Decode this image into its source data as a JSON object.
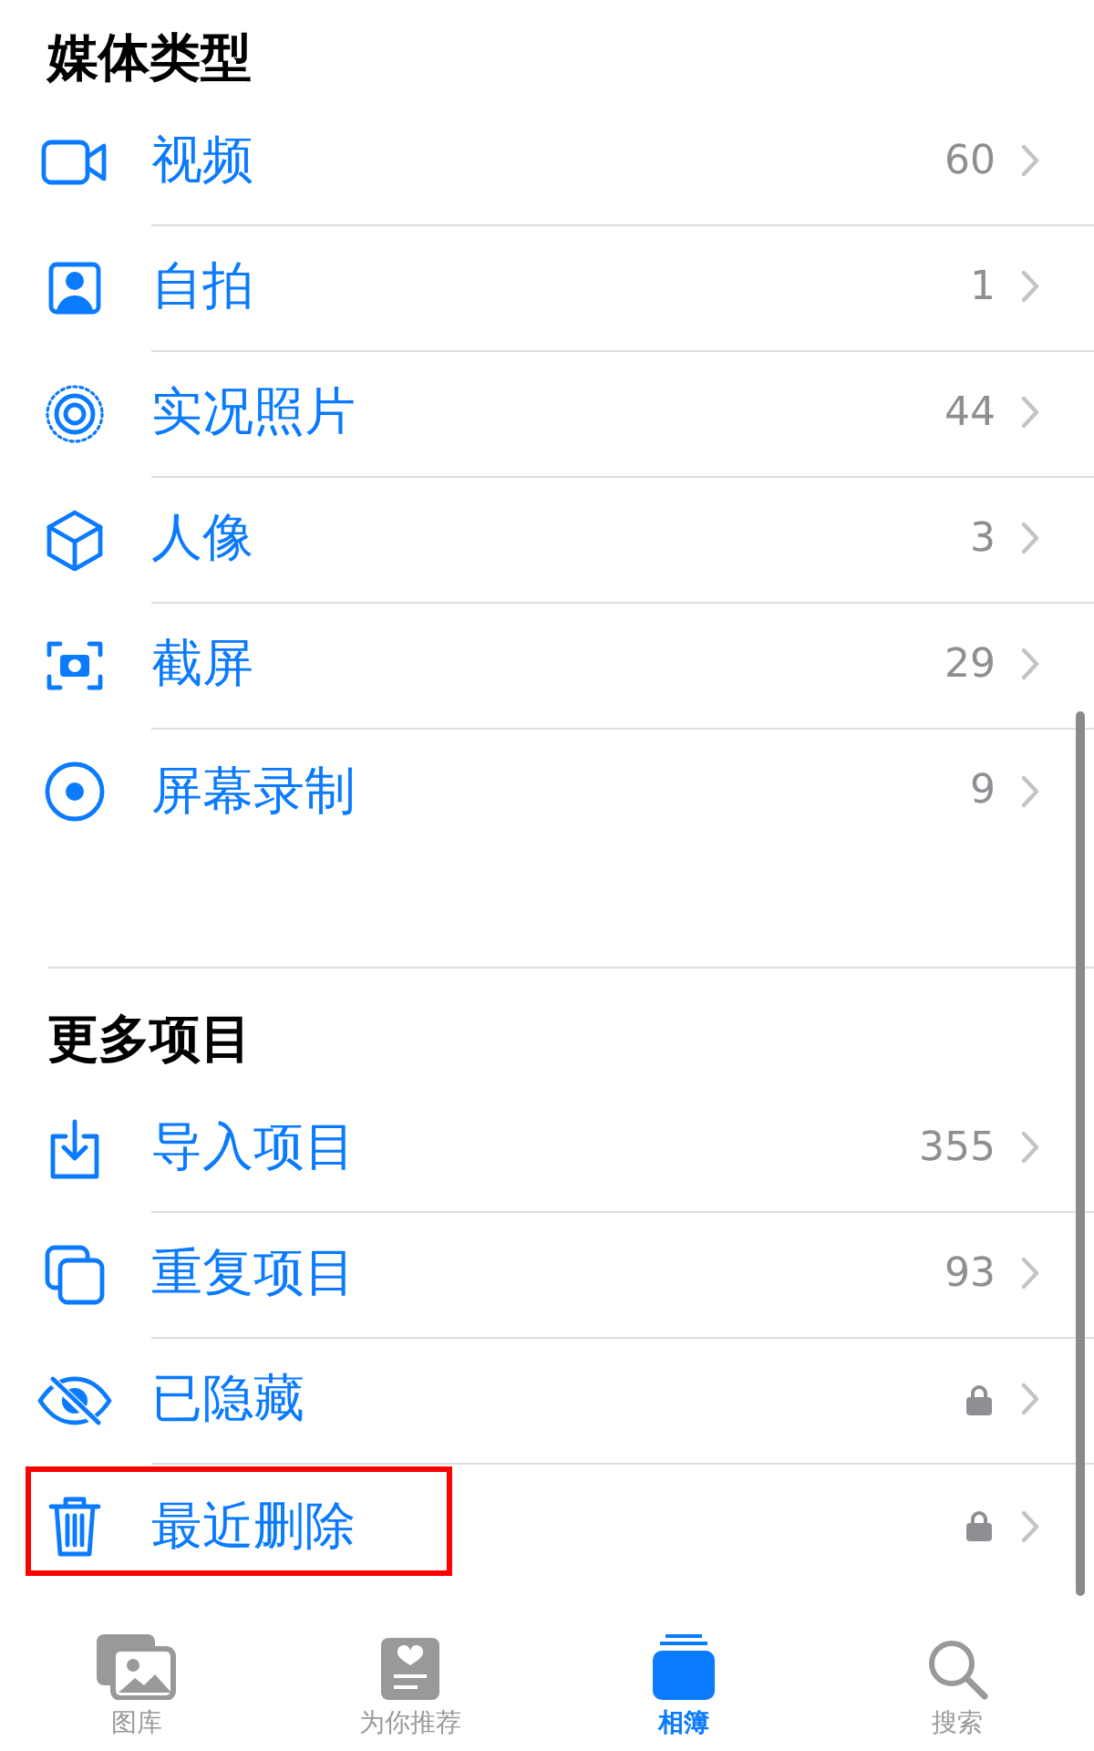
{
  "sections": [
    {
      "title": "媒体类型",
      "items": [
        {
          "label": "视频",
          "kind": "count",
          "count": "60",
          "highlighted": false
        },
        {
          "label": "自拍",
          "kind": "count",
          "count": "1",
          "highlighted": false
        },
        {
          "label": "实况照片",
          "kind": "count",
          "count": "44",
          "highlighted": false
        },
        {
          "label": "人像",
          "kind": "count",
          "count": "3",
          "highlighted": false
        },
        {
          "label": "截屏",
          "kind": "count",
          "count": "29",
          "highlighted": false
        },
        {
          "label": "屏幕录制",
          "kind": "count",
          "count": "9",
          "highlighted": false
        }
      ]
    },
    {
      "title": "更多项目",
      "items": [
        {
          "label": "导入项目",
          "kind": "count",
          "count": "355",
          "highlighted": false
        },
        {
          "label": "重复项目",
          "kind": "count",
          "count": "93",
          "highlighted": false
        },
        {
          "label": "已隐藏",
          "kind": "locked",
          "highlighted": false
        },
        {
          "label": "最近删除",
          "kind": "locked",
          "highlighted": true
        }
      ]
    }
  ],
  "tab_bar": [
    {
      "label": "图库",
      "selected": false
    },
    {
      "label": "为你推荐",
      "selected": false
    },
    {
      "label": "相簿",
      "selected": true
    },
    {
      "label": "搜索",
      "selected": false
    }
  ]
}
